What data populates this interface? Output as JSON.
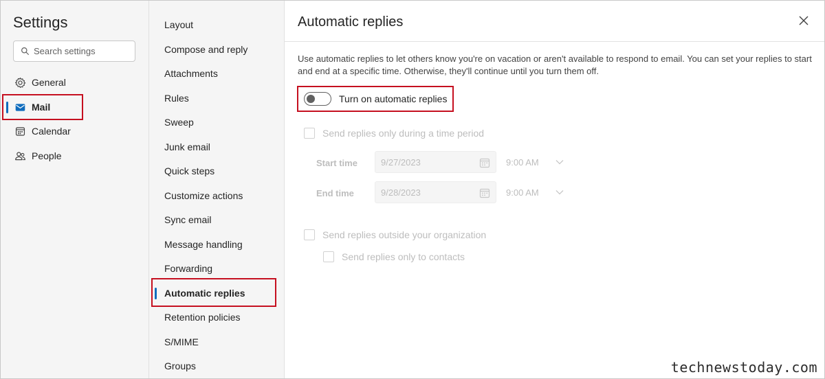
{
  "left": {
    "title": "Settings",
    "search_placeholder": "Search settings",
    "items": [
      {
        "label": "General",
        "icon": "gear-icon"
      },
      {
        "label": "Mail",
        "icon": "mail-icon",
        "selected": true
      },
      {
        "label": "Calendar",
        "icon": "calendar-icon"
      },
      {
        "label": "People",
        "icon": "people-icon"
      }
    ]
  },
  "middle": {
    "items": [
      "Layout",
      "Compose and reply",
      "Attachments",
      "Rules",
      "Sweep",
      "Junk email",
      "Quick steps",
      "Customize actions",
      "Sync email",
      "Message handling",
      "Forwarding",
      "Automatic replies",
      "Retention policies",
      "S/MIME",
      "Groups"
    ],
    "selected": "Automatic replies"
  },
  "main": {
    "title": "Automatic replies",
    "description": "Use automatic replies to let others know you're on vacation or aren't available to respond to email. You can set your replies to start and end at a specific time. Otherwise, they'll continue until you turn them off.",
    "toggle_label": "Turn on automatic replies",
    "toggle_on": false,
    "time_period_label": "Send replies only during a time period",
    "start_label": "Start time",
    "start_date": "9/27/2023",
    "start_time": "9:00 AM",
    "end_label": "End time",
    "end_date": "9/28/2023",
    "end_time": "9:00 AM",
    "outside_org_label": "Send replies outside your organization",
    "contacts_only_label": "Send replies only to contacts"
  },
  "colors": {
    "accent": "#0f6cbd",
    "highlight": "#c50f1f"
  },
  "watermark": "technewstoday.com"
}
